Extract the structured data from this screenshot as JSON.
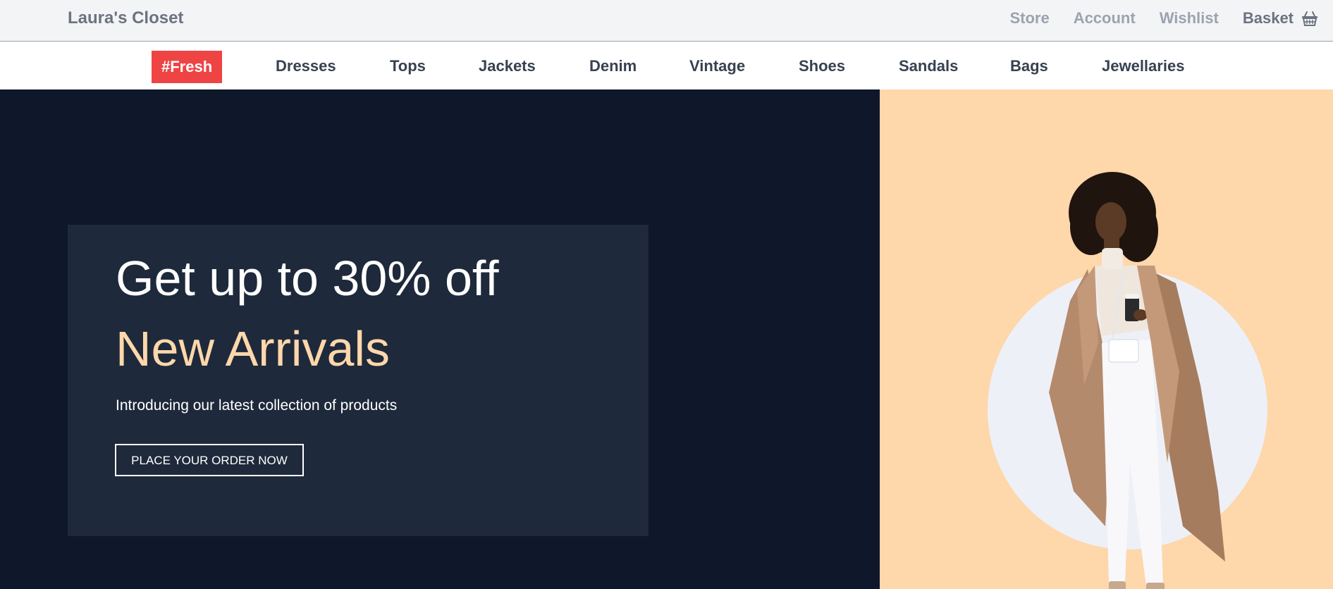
{
  "header": {
    "brand": "Laura's Closet",
    "links": [
      {
        "label": "Store"
      },
      {
        "label": "Account"
      },
      {
        "label": "Wishlist"
      },
      {
        "label": "Basket"
      }
    ]
  },
  "categories": [
    {
      "label": "#Fresh"
    },
    {
      "label": "Dresses"
    },
    {
      "label": "Tops"
    },
    {
      "label": "Jackets"
    },
    {
      "label": "Denim"
    },
    {
      "label": "Vintage"
    },
    {
      "label": "Shoes"
    },
    {
      "label": "Sandals"
    },
    {
      "label": "Bags"
    },
    {
      "label": "Jewellaries"
    }
  ],
  "hero": {
    "title": "Get up to 30% off",
    "subtitle": "New Arrivals",
    "description": "Introducing our latest collection of products",
    "cta": "PLACE YOUR ORDER NOW"
  },
  "icons": {
    "basket": "basket-icon"
  },
  "colors": {
    "accent": "#ef4444",
    "hero_dark": "#0f172a",
    "promo_panel": "#1e293b",
    "peach": "#fed7aa"
  }
}
